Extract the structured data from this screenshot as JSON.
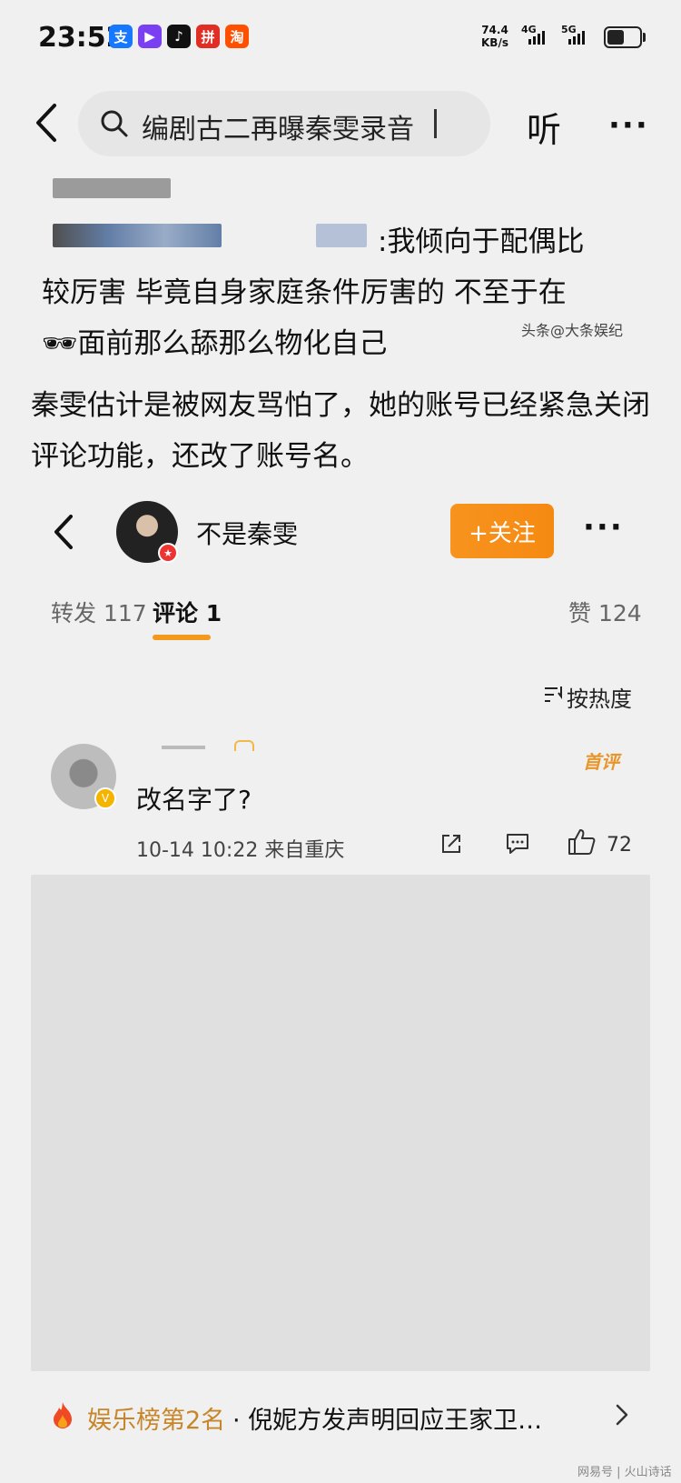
{
  "status_bar": {
    "time": "23:52",
    "apps": [
      {
        "name": "alipay-icon",
        "glyph": "支",
        "color": "#1677ff"
      },
      {
        "name": "video-app-icon",
        "glyph": "▶",
        "color": "#7b3ff2"
      },
      {
        "name": "tiktok-icon",
        "glyph": "♪",
        "color": "#111111"
      },
      {
        "name": "pinduoduo-icon",
        "glyph": "拼",
        "color": "#e02e24"
      },
      {
        "name": "taobao-icon",
        "glyph": "淘",
        "color": "#ff5000"
      }
    ],
    "net_speed": "74.4",
    "net_unit": "KB/s",
    "signal_1": "4G",
    "signal_2": "5G"
  },
  "search_bar": {
    "query": "编剧古二再曝秦雯录音",
    "listen_label": "听",
    "more_label": "···"
  },
  "article": {
    "quote_line1": ":我倾向于配偶比",
    "quote_line2": "较厉害 毕竟自身家庭条件厉害的 不至于在",
    "quote_line3": "🕶面前那么舔那么物化自己",
    "watermark": "头条@大条娱纪",
    "paragraph": "秦雯估计是被网友骂怕了，她的账号已经紧急关闭评论功能，还改了账号名。"
  },
  "weibo_card": {
    "username": "不是秦雯",
    "follow_label": "+关注",
    "more_label": "···",
    "tabs": [
      {
        "label": "转发 117"
      },
      {
        "label": "评论 1"
      }
    ],
    "likes_label": "赞 124",
    "sort_label": "按热度",
    "comment": {
      "first_tag": "首评",
      "text": "改名字了?",
      "meta": "10-14 10:22  来自重庆",
      "like_count": "72"
    }
  },
  "hot_rank": {
    "label": "娱乐榜第2名",
    "title": "· 倪妮方发声明回应王家卫…"
  },
  "watermark2": "网易号 | 火山诗话"
}
